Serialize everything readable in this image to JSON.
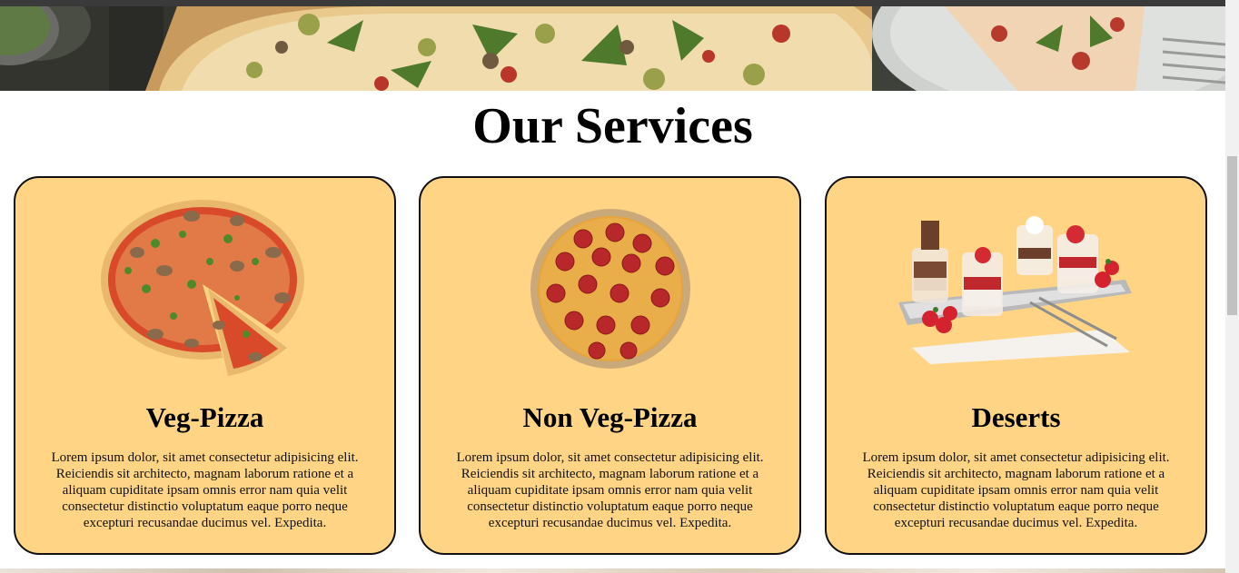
{
  "page": {
    "title": "Our Services"
  },
  "services": [
    {
      "name": "Veg-Pizza",
      "image_icon": "veg-pizza-image",
      "description": "Lorem ipsum dolor, sit amet consectetur adipisicing elit. Reiciendis sit architecto, magnam laborum ratione et a aliquam cupiditate ipsam omnis error nam quia velit consectetur distinctio voluptatum eaque porro neque excepturi recusandae ducimus vel. Expedita."
    },
    {
      "name": "Non Veg-Pizza",
      "image_icon": "pepperoni-pizza-image",
      "description": "Lorem ipsum dolor, sit amet consectetur adipisicing elit. Reiciendis sit architecto, magnam laborum ratione et a aliquam cupiditate ipsam omnis error nam quia velit consectetur distinctio voluptatum eaque porro neque excepturi recusandae ducimus vel. Expedita."
    },
    {
      "name": "Deserts",
      "image_icon": "dessert-cups-image",
      "description": "Lorem ipsum dolor, sit amet consectetur adipisicing elit. Reiciendis sit architecto, magnam laborum ratione et a aliquam cupiditate ipsam omnis error nam quia velit consectetur distinctio voluptatum eaque porro neque excepturi recusandae ducimus vel. Expedita."
    }
  ],
  "colors": {
    "card_background": "#ffd585",
    "card_border": "#111111",
    "text": "#000000"
  }
}
